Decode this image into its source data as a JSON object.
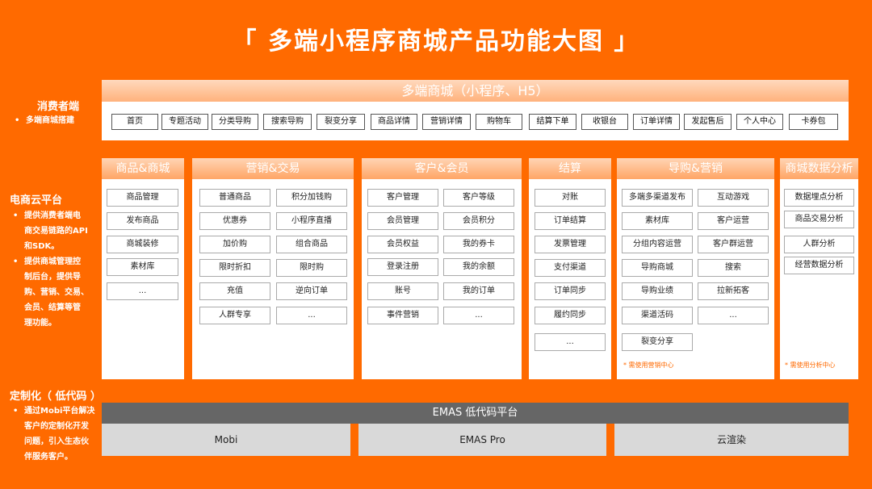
{
  "title": "「 多端小程序商城产品功能大图 」",
  "side": {
    "consumer_title": "消费者端",
    "consumer_items": [
      "多端商城搭建"
    ],
    "cloud_title": "电商云平台",
    "cloud_items": [
      [
        "提供消费者端电",
        "商交易链路的API",
        "和SDK。"
      ],
      [
        "提供商城管理控",
        "制后台，提供导",
        "购、营销、交易、",
        "会员、结算等管",
        "理功能。"
      ]
    ],
    "custom_title": "定制化（ 低代码 ）",
    "custom_items": [
      [
        "通过Mobi平台解决",
        "客户的定制化开发",
        "问题，引入生态伙",
        "伴服务客户。"
      ]
    ]
  },
  "consumer": {
    "header": "多端商城（小程序、H5）",
    "items": [
      "首页",
      "专题活动",
      "分类导购",
      "搜索导购",
      "裂变分享",
      "商品详情",
      "营销详情",
      "购物车",
      "结算下单",
      "收银台",
      "订单详情",
      "发起售后",
      "个人中心",
      "卡券包"
    ]
  },
  "columns": [
    {
      "header": "商品&商城",
      "items": [
        "商品管理",
        "发布商品",
        "商城装修",
        "素材库",
        "..."
      ]
    },
    {
      "header": "营销&交易",
      "items": [
        "普通商品",
        "积分加钱购",
        "优惠券",
        "小程序直播",
        "加价购",
        "组合商品",
        "限时折扣",
        "限时购",
        "充值",
        "逆向订单",
        "人群专享",
        "..."
      ]
    },
    {
      "header": "客户&会员",
      "items": [
        "客户管理",
        "客户等级",
        "会员管理",
        "会员积分",
        "会员权益",
        "我的券卡",
        "登录注册",
        "我的余额",
        "账号",
        "我的订单",
        "事件营销",
        "..."
      ]
    },
    {
      "header": "结算",
      "items": [
        "对账",
        "订单结算",
        "发票管理",
        "支付渠道",
        "订单同步",
        "履约同步",
        "..."
      ]
    },
    {
      "header": "导购&营销",
      "items": [
        "多端多渠道发布",
        "互动游戏",
        "素材库",
        "客户运营",
        "分组内容运营",
        "客户群运营",
        "导购商城",
        "搜索",
        "导购业绩",
        "拉新拓客",
        "渠道活码",
        "...",
        "裂变分享"
      ],
      "note": "* 需使用营销中心"
    },
    {
      "header": "商城数据分析",
      "items": [
        "数据埋点分析",
        "商品交易分析",
        "人群分析",
        "经营数据分析"
      ],
      "note": "* 需使用分析中心"
    }
  ],
  "platform": {
    "header": "EMAS 低代码平台",
    "items": [
      "Mobi",
      "EMAS Pro",
      "云渲染"
    ]
  }
}
